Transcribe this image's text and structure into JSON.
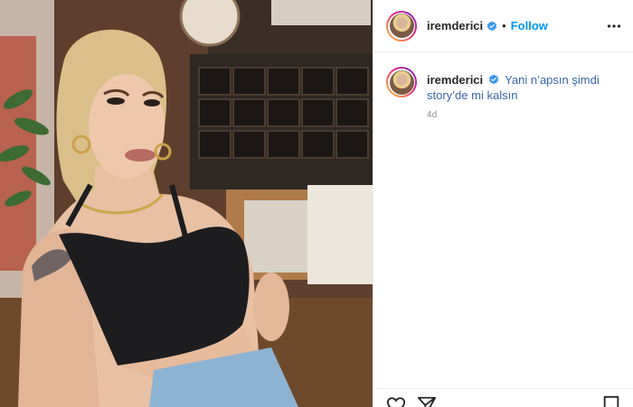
{
  "post": {
    "username": "iremderici",
    "separator": "•",
    "follow_label": "Follow",
    "caption_username": "iremderici",
    "caption_text": "Yani n’apsın şimdi story’de mi kalsın",
    "time_ago": "4d"
  },
  "colors": {
    "accent": "#0095f6",
    "verified": "#3897f0",
    "caption_link": "#3a66a8",
    "muted": "#8e8e8e"
  },
  "icons": {
    "verified": "verified-badge-icon",
    "more": "more-options-icon",
    "like": "heart-icon",
    "share": "paper-plane-icon",
    "save": "bookmark-icon"
  }
}
